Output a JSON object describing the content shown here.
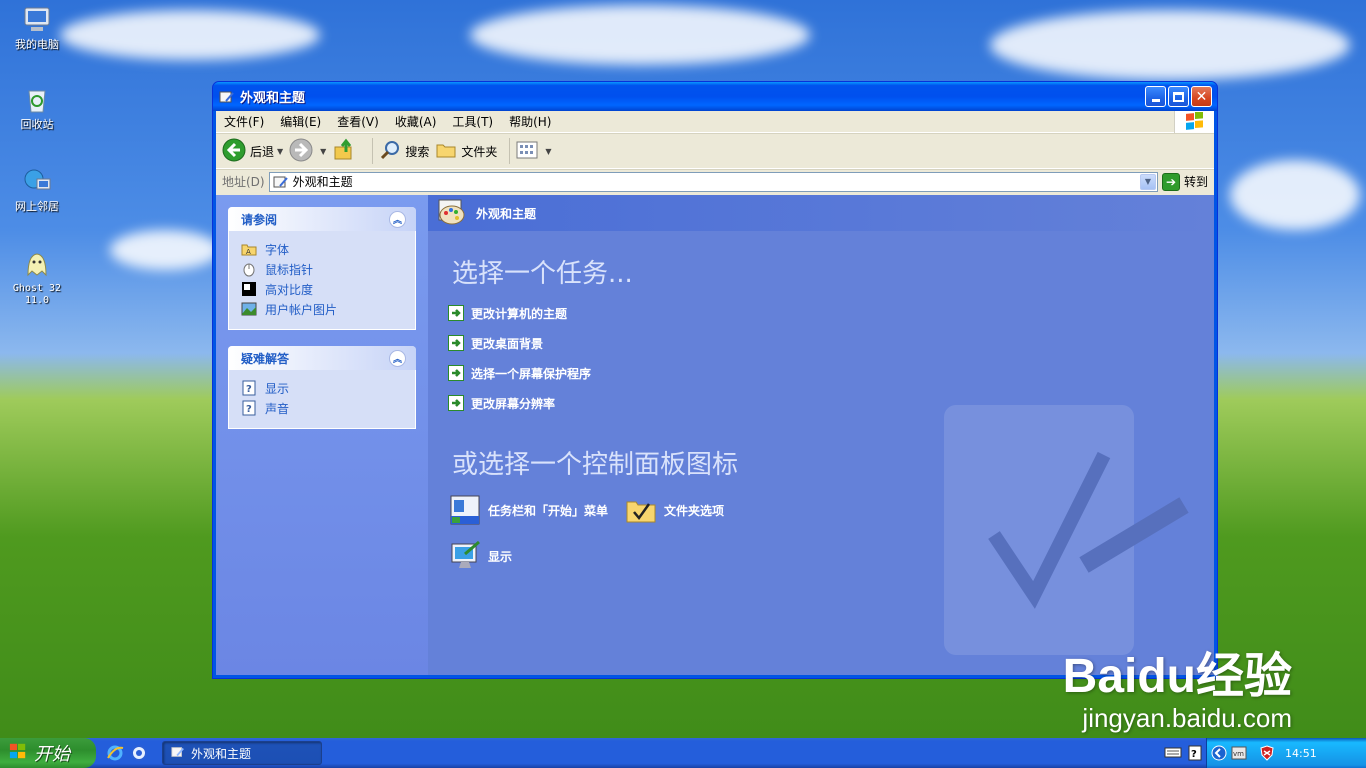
{
  "desktop": {
    "icons": [
      {
        "label": "我的电脑",
        "icon": "computer-icon"
      },
      {
        "label": "回收站",
        "icon": "recycle-bin-icon"
      },
      {
        "label": "网上邻居",
        "icon": "network-icon"
      },
      {
        "label": "Ghost 32\n11.0",
        "icon": "ghost-icon"
      }
    ]
  },
  "window": {
    "title": "外观和主题",
    "menu": [
      "文件(F)",
      "编辑(E)",
      "查看(V)",
      "收藏(A)",
      "工具(T)",
      "帮助(H)"
    ],
    "toolbar": {
      "back": "后退",
      "search": "搜索",
      "folders": "文件夹"
    },
    "address": {
      "label": "地址(D)",
      "value": "外观和主题",
      "go": "转到"
    }
  },
  "taskpane": {
    "see_also": {
      "title": "请参阅",
      "items": [
        "字体",
        "鼠标指针",
        "高对比度",
        "用户帐户图片"
      ]
    },
    "troubleshoot": {
      "title": "疑难解答",
      "items": [
        "显示",
        "声音"
      ]
    }
  },
  "main": {
    "header": "外观和主题",
    "pick_task": "选择一个任务...",
    "tasks": [
      "更改计算机的主题",
      "更改桌面背景",
      "选择一个屏幕保护程序",
      "更改屏幕分辨率"
    ],
    "pick_icon": "或选择一个控制面板图标",
    "cp_icons": [
      "任务栏和「开始」菜单",
      "文件夹选项",
      "显示"
    ]
  },
  "taskbar": {
    "start": "开始",
    "task_button": "外观和主题",
    "clock": "14:51"
  },
  "watermark": {
    "logo": "Baidu经验",
    "url": "jingyan.baidu.com"
  },
  "colors": {
    "accent": "#215dc6",
    "main_bg": "#6481d9",
    "title_bar": "#0053ee"
  }
}
